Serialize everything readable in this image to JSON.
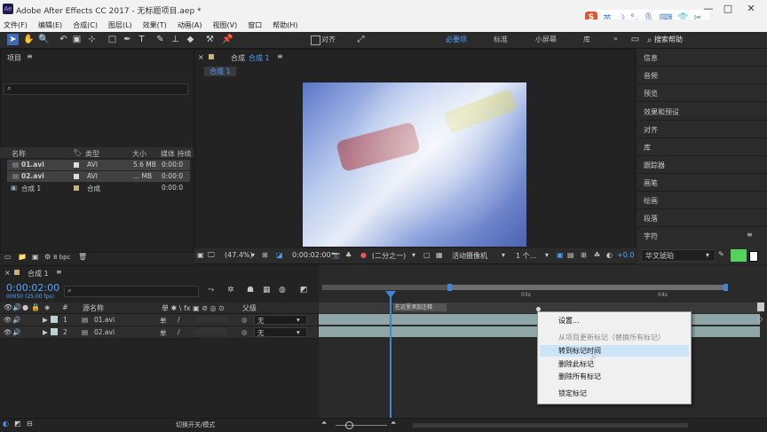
{
  "window": {
    "title": "Adobe After Effects CC 2017 - 无标题项目.aep *",
    "app_icon_text": "Ae",
    "minimize_label": "—",
    "maximize_label": "□",
    "close_label": "✕"
  },
  "ime": {
    "logo": "S",
    "mode": "英"
  },
  "menu": [
    "文件(F)",
    "编辑(E)",
    "合成(C)",
    "图层(L)",
    "效果(T)",
    "动画(A)",
    "视图(V)",
    "窗口",
    "帮助(H)"
  ],
  "toolbar": {
    "align_label": "对齐",
    "workspaces": [
      "必要项",
      "标准",
      "小屏幕",
      "库"
    ],
    "search_placeholder": "搜索帮助"
  },
  "project_panel": {
    "title": "项目",
    "columns": [
      "名称",
      "类型",
      "大小",
      "媒体 持续"
    ],
    "items": [
      {
        "name": "01.avi",
        "type": "AVI",
        "size": "5.6 MB",
        "duration": "0:00:0"
      },
      {
        "name": "02.avi",
        "type": "AVI",
        "size": "... MB",
        "duration": "0:00:0"
      },
      {
        "name": "合成 1",
        "type": "合成",
        "size": "",
        "duration": "0:00:0"
      }
    ],
    "bpc_label": "8 bpc"
  },
  "viewer": {
    "panel_title": "合成",
    "comp_name": "合成 1",
    "comp_tab": "合成 1",
    "zoom": "(47.4%)",
    "timecode": "0:00:02:00",
    "resolution": "(二分之一)",
    "camera": "活动摄像机",
    "views": "1 个...",
    "exposure": "+0.0"
  },
  "right_panel": {
    "items": [
      "信息",
      "音频",
      "预览",
      "效果和预设",
      "对齐",
      "库",
      "跟踪器",
      "画笔",
      "绘画",
      "段落",
      "字符"
    ],
    "font_name": "华文琥珀"
  },
  "timeline": {
    "comp_name": "合成 1",
    "timecode": "0:00:02:00",
    "fps_label": "00050 (25.00 fps)",
    "columns": {
      "num": "#",
      "source": "源名称",
      "parent": "父级"
    },
    "layers": [
      {
        "num": "1",
        "name": "01.avi",
        "parent": "无"
      },
      {
        "num": "2",
        "name": "02.avi",
        "parent": "无"
      }
    ],
    "ruler_marks": [
      "03s",
      "04s"
    ],
    "marker_label": "在这里添加注释",
    "toggle_label": "切换开关/模式"
  },
  "context_menu": {
    "items": [
      {
        "label": "设置...",
        "disabled": false,
        "highlighted": false
      },
      {
        "label": "从项目更新标记（替换所有标记）",
        "disabled": true,
        "highlighted": false
      },
      {
        "label": "转到标记时间",
        "disabled": false,
        "highlighted": true
      },
      {
        "label": "删除此标记",
        "disabled": false,
        "highlighted": false
      },
      {
        "label": "删除所有标记",
        "disabled": false,
        "highlighted": false
      },
      {
        "label": "锁定标记",
        "disabled": false,
        "highlighted": false
      }
    ]
  },
  "colors": {
    "accent_blue": "#3d87d6",
    "track_green": "#8fa6a6",
    "timecode_blue": "#58a6ff",
    "menu_highlight": "#cce4f7"
  }
}
